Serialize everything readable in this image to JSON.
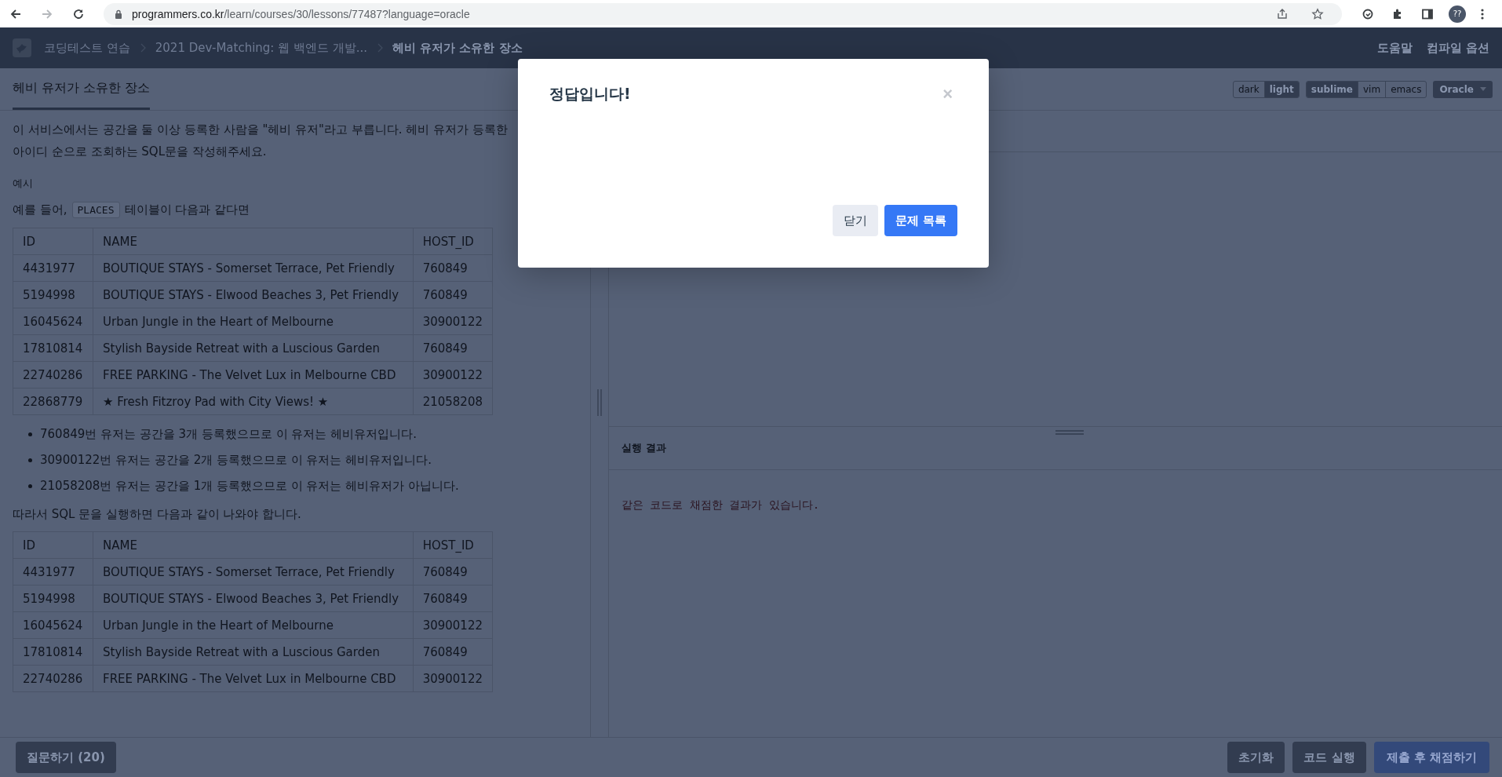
{
  "browser": {
    "nav_buttons": [
      {
        "kind": "back",
        "disabled": false
      },
      {
        "kind": "forward",
        "disabled": true
      },
      {
        "kind": "reload",
        "disabled": false
      }
    ],
    "url_host": "programmers.co.kr",
    "url_path": "/learn/courses/30/lessons/77487?language=oracle",
    "profile": "??"
  },
  "header": {
    "breadcrumbs": [
      {
        "label": "코딩테스트 연습",
        "current": false
      },
      {
        "label": "2021 Dev-Matching: 웹 백엔드 개발...",
        "current": false
      },
      {
        "label": "헤비 유저가 소유한 장소",
        "current": true
      }
    ],
    "links": [
      "도움말",
      "컴파일 옵션"
    ]
  },
  "problem": {
    "tab": {
      "label": "헤비 유저가 소유한 장소",
      "selected": true
    },
    "description": [
      "이 서비스에서는 공간을 둘 이상 등록한 사람을 \"헤비 유저\"라고 부릅니다. 헤비 유저가 등록한",
      "아이디 순으로 조회하는 SQL문을 작성해주세요."
    ],
    "example_heading": "예시",
    "intro": {
      "before": "예를 들어,",
      "code": "PLACES",
      "after": "테이블이 다음과 같다면"
    },
    "table_1": {
      "columns": [
        "ID",
        "NAME",
        "HOST_ID"
      ],
      "rows": [
        [
          "4431977",
          "BOUTIQUE STAYS - Somerset Terrace, Pet Friendly",
          "760849"
        ],
        [
          "5194998",
          "BOUTIQUE STAYS - Elwood Beaches 3, Pet Friendly",
          "760849"
        ],
        [
          "16045624",
          "Urban Jungle in the Heart of Melbourne",
          "30900122"
        ],
        [
          "17810814",
          "Stylish Bayside Retreat with a Luscious Garden",
          "760849"
        ],
        [
          "22740286",
          "FREE PARKING - The Velvet Lux in Melbourne CBD",
          "30900122"
        ],
        [
          "22868779",
          "★ Fresh Fitzroy Pad with City Views! ★",
          "21058208"
        ]
      ]
    },
    "bullets": [
      "760849번 유저는 공간을 3개 등록했으므로 이 유저는 헤비유저입니다.",
      "30900122번 유저는 공간을 2개 등록했으므로 이 유저는 헤비유저입니다.",
      "21058208번 유저는 공간을 1개 등록했으므로 이 유저는 헤비유저가 아닙니다."
    ],
    "conclusion": "따라서 SQL 문을 실행하면 다음과 같이 나와야 합니다.",
    "table_2": {
      "columns": [
        "ID",
        "NAME",
        "HOST_ID"
      ],
      "rows": [
        [
          "4431977",
          "BOUTIQUE STAYS - Somerset Terrace, Pet Friendly",
          "760849"
        ],
        [
          "5194998",
          "BOUTIQUE STAYS - Elwood Beaches 3, Pet Friendly",
          "760849"
        ],
        [
          "16045624",
          "Urban Jungle in the Heart of Melbourne",
          "30900122"
        ],
        [
          "17810814",
          "Stylish Bayside Retreat with a Luscious Garden",
          "760849"
        ],
        [
          "22740286",
          "FREE PARKING - The Velvet Lux in Melbourne CBD",
          "30900122"
        ]
      ]
    }
  },
  "editor": {
    "toggle_groups": [
      [
        {
          "label": "dark",
          "selected": false
        },
        {
          "label": "light",
          "selected": true
        }
      ],
      [
        {
          "label": "sublime",
          "selected": true
        },
        {
          "label": "vim",
          "selected": false
        },
        {
          "label": "emacs",
          "selected": false
        }
      ]
    ],
    "language": "Oracle",
    "result_title": "실행 결과",
    "result_message": "같은 코드로 채점한 결과가 있습니다."
  },
  "footer": {
    "ask_button": "질문하기 (20)",
    "actions": [
      {
        "label": "초기화",
        "kind": "secondary"
      },
      {
        "label": "코드 실행",
        "kind": "secondary"
      },
      {
        "label": "제출 후 채점하기",
        "kind": "primary"
      }
    ]
  },
  "modal": {
    "title": "정답입니다!",
    "close": "×",
    "buttons": [
      {
        "label": "닫기",
        "kind": "secondary"
      },
      {
        "label": "문제 목록",
        "kind": "primary"
      }
    ]
  }
}
